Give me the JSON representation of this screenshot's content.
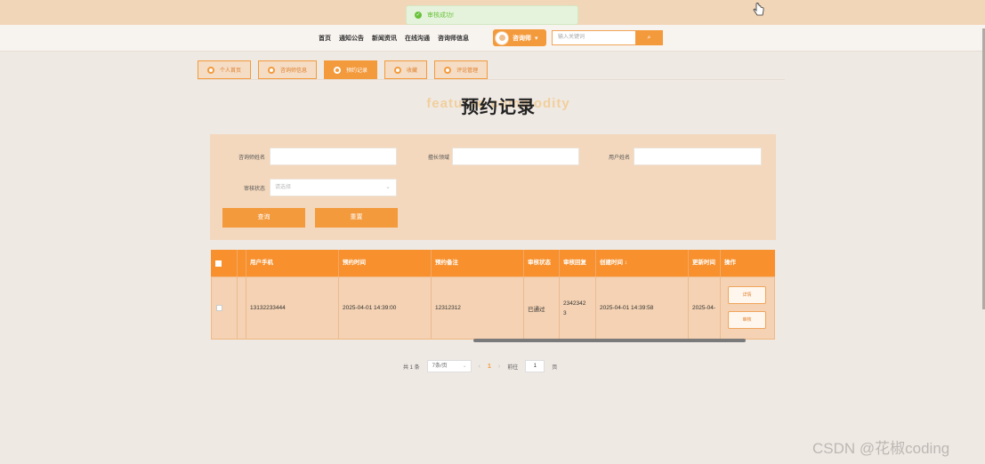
{
  "toast": {
    "message": "审核成功!"
  },
  "nav": {
    "links": [
      "首页",
      "通知公告",
      "新闻资讯",
      "在线沟通",
      "咨询师信息"
    ],
    "user_label": "咨询师",
    "search_placeholder": "输入关键词",
    "search_button": "🔍"
  },
  "tabs": [
    "个人首页",
    "咨询师信息",
    "预约记录",
    "收藏",
    "评论管理"
  ],
  "page": {
    "title": "预约记录",
    "title_bg": "featured commodity"
  },
  "filter": {
    "counselor_name_label": "咨询师姓名",
    "specialty_label": "擅长领域",
    "user_name_label": "用户姓名",
    "audit_status_label": "审核状态",
    "audit_status_placeholder": "请选择",
    "query_button": "查询",
    "reset_button": "重置"
  },
  "table": {
    "headers": [
      "用户手机",
      "预约时间",
      "预约备注",
      "审核状态",
      "审核回复",
      "创建时间 ↕",
      "更新时间",
      "操作"
    ],
    "rows": [
      {
        "phone": "13132233444",
        "appointment_time": "2025-04-01 14:39:00",
        "note": "12312312",
        "audit_status": "已通过",
        "audit_reply": "2342342\n3",
        "created": "2025-04-01 14:39:58",
        "updated": "2025-04-",
        "actions": [
          "详情",
          "审核"
        ]
      }
    ]
  },
  "pager": {
    "total": "共 1 条",
    "page_size": "7条/页",
    "current": "1",
    "goto_label": "前往",
    "goto_value": "1",
    "page_suffix": "页"
  },
  "watermark": "CSDN @花椒coding"
}
